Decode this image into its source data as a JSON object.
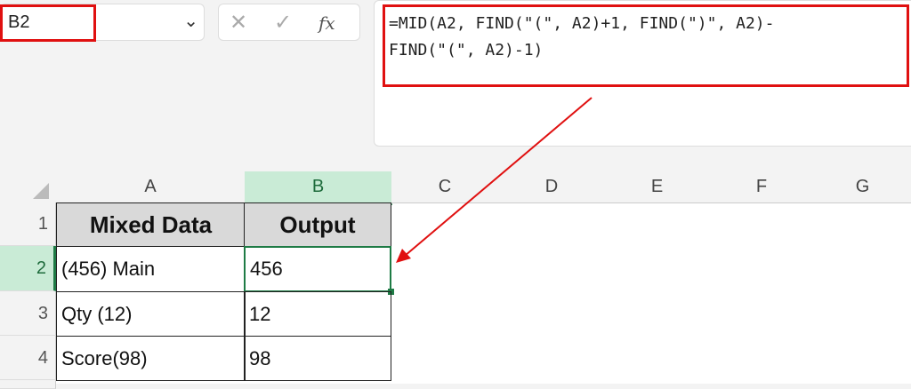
{
  "name_box": {
    "value": "B2"
  },
  "formula_bar": {
    "cancel_icon": "✕",
    "enter_icon": "✓",
    "fx_label": "fx",
    "formula": "=MID(A2, FIND(\"(\", A2)+1, FIND(\")\", A2)-\nFIND(\"(\", A2)-1)"
  },
  "columns": [
    "A",
    "B",
    "C",
    "D",
    "E",
    "F",
    "G"
  ],
  "rows": [
    "1",
    "2",
    "3",
    "4"
  ],
  "table": {
    "headers": [
      "Mixed Data",
      "Output"
    ],
    "data": [
      [
        "(456) Main",
        "456"
      ],
      [
        "Qty (12)",
        "12"
      ],
      [
        "Score(98)",
        "98"
      ]
    ]
  },
  "colors": {
    "highlight": "#e01010",
    "selection": "#1e7b45"
  }
}
